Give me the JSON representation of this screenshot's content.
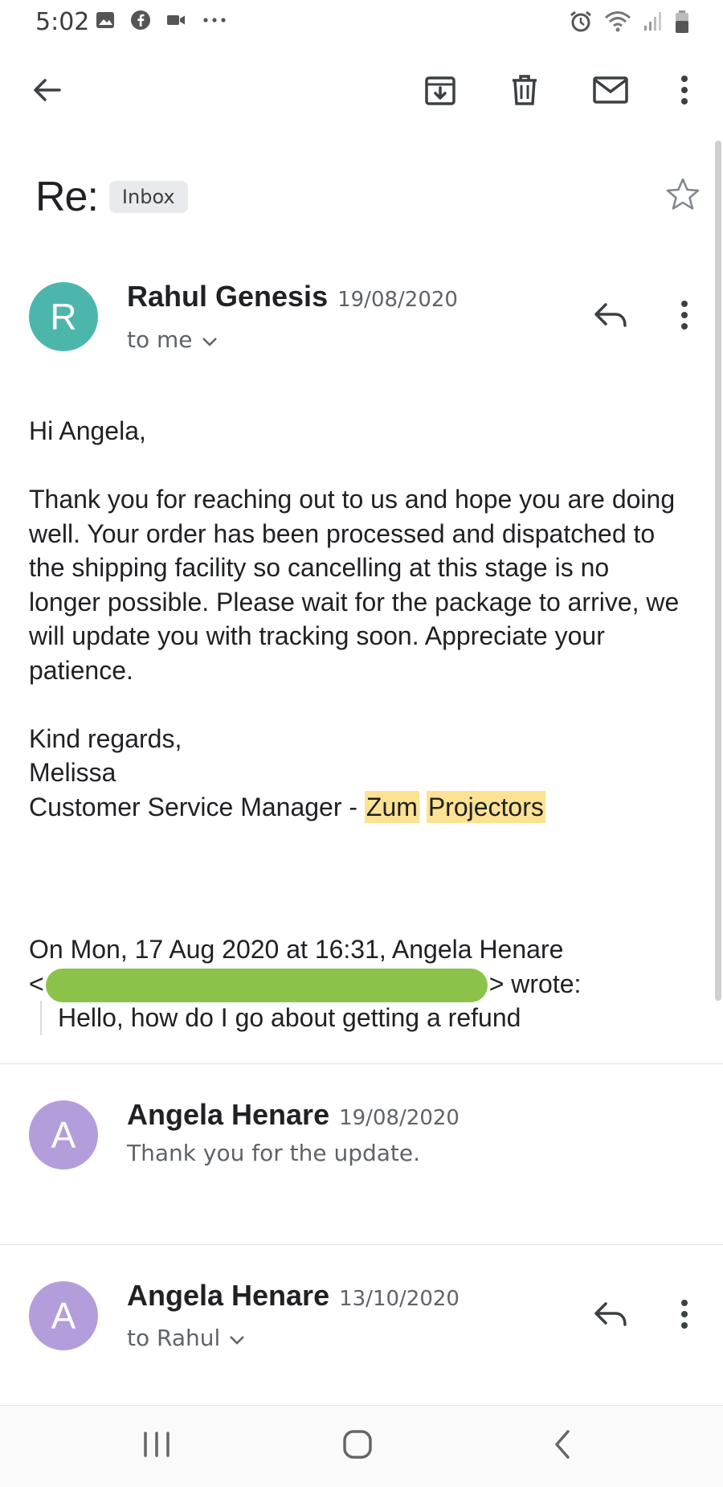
{
  "status_bar": {
    "time": "5:02",
    "left_icons": [
      "image-icon",
      "facebook-icon",
      "video-icon",
      "more-dots-icon"
    ],
    "right_icons": [
      "alarm-icon",
      "wifi-icon",
      "signal-icon",
      "battery-icon"
    ]
  },
  "app_bar": {
    "actions": [
      "back-arrow-icon",
      "archive-icon",
      "trash-icon",
      "mark-unread-icon",
      "more-vert-icon"
    ]
  },
  "subject": {
    "title": "Re:",
    "label": "Inbox"
  },
  "messages": [
    {
      "avatar_letter": "R",
      "avatar_color": "#4db6ac",
      "sender": "Rahul Genesis",
      "date": "19/08/2020",
      "recipient": "to me",
      "body": {
        "greeting": "Hi Angela,",
        "paragraph": "Thank you for reaching out to us and hope you are doing well. Your order has been processed and dispatched to the shipping facility so cancelling at this stage is no longer possible. Please wait for the package to arrive, we will update you with tracking soon. Appreciate your patience.",
        "signoff": "Kind regards,",
        "signature_name": "Melissa",
        "signature_title_prefix": "Customer Service Manager - ",
        "signature_company_1": "Zum",
        "signature_company_2": "Projectors",
        "quote_header_1": "On Mon, 17 Aug 2020 at 16:31, Angela Henare",
        "quote_header_open": "<",
        "quote_header_2": "> wrote:",
        "quoted_text": "Hello, how do I go about getting a refund"
      }
    },
    {
      "avatar_letter": "A",
      "avatar_color": "#b39ddb",
      "sender": "Angela Henare",
      "date": "19/08/2020",
      "snippet": "Thank you for the update."
    },
    {
      "avatar_letter": "A",
      "avatar_color": "#b39ddb",
      "sender": "Angela Henare",
      "date": "13/10/2020",
      "recipient": "to Rahul"
    }
  ],
  "nav_bar": {
    "buttons": [
      "recent-apps-icon",
      "home-icon",
      "back-icon"
    ]
  },
  "colors": {
    "highlight": "#fde293",
    "redaction": "#8bc34a"
  }
}
